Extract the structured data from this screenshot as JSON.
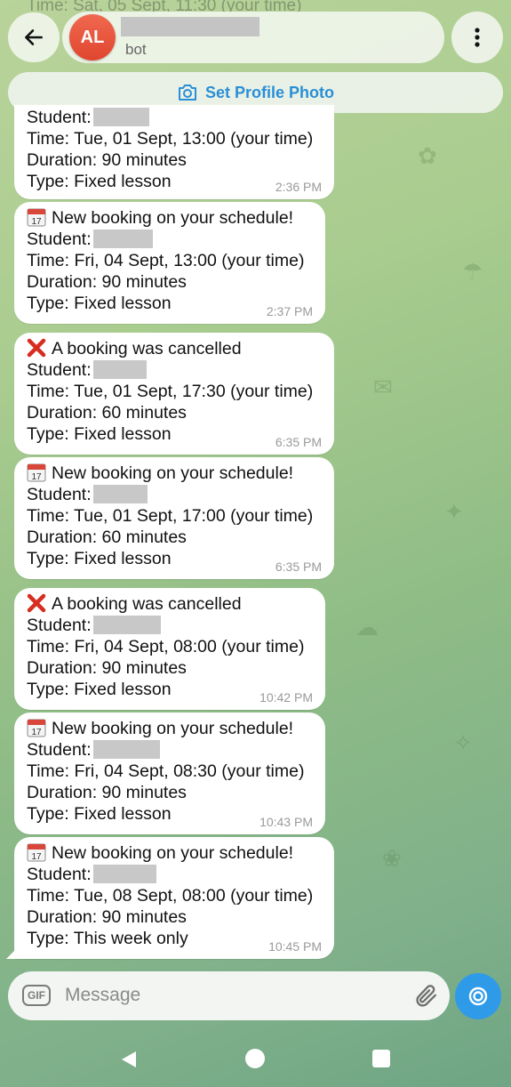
{
  "header": {
    "peek_line": "Time: Sat, 05 Sept, 11:30 (your time)",
    "avatar_initials": "AL",
    "subtitle": "bot",
    "set_profile_photo": "Set Profile Photo"
  },
  "messages": [
    {
      "title": "",
      "icon": "",
      "student_label": "Student:",
      "time": "Time: Tue, 01 Sept, 13:00 (your time)",
      "duration": "Duration: 90 minutes",
      "type": "Type: Fixed lesson",
      "timestamp": "2:36 PM"
    },
    {
      "title": "New booking on your schedule!",
      "icon": "calendar-icon",
      "student_label": "Student:",
      "time": "Time: Fri, 04 Sept, 13:00 (your time)",
      "duration": "Duration: 90 minutes",
      "type": "Type: Fixed lesson",
      "timestamp": "2:37 PM"
    },
    {
      "title": "A booking was cancelled",
      "icon": "cross-mark-icon",
      "student_label": "Student:",
      "time": "Time: Tue, 01 Sept, 17:30 (your time)",
      "duration": "Duration: 60 minutes",
      "type": "Type: Fixed lesson",
      "timestamp": "6:35 PM"
    },
    {
      "title": "New booking on your schedule!",
      "icon": "calendar-icon",
      "student_label": "Student:",
      "time": "Time: Tue, 01 Sept, 17:00 (your time)",
      "duration": "Duration: 60 minutes",
      "type": "Type: Fixed lesson",
      "timestamp": "6:35 PM"
    },
    {
      "title": "A booking was cancelled",
      "icon": "cross-mark-icon",
      "student_label": "Student:",
      "time": "Time: Fri, 04 Sept, 08:00 (your time)",
      "duration": "Duration: 90 minutes",
      "type": "Type: Fixed lesson",
      "timestamp": "10:42 PM"
    },
    {
      "title": "New booking on your schedule!",
      "icon": "calendar-icon",
      "student_label": "Student:",
      "time": "Time: Fri, 04 Sept, 08:30 (your time)",
      "duration": "Duration: 90 minutes",
      "type": "Type: Fixed lesson",
      "timestamp": "10:43 PM"
    },
    {
      "title": "New booking on your schedule!",
      "icon": "calendar-icon",
      "student_label": "Student:",
      "time": "Time: Tue, 08 Sept, 08:00 (your time)",
      "duration": "Duration: 90 minutes",
      "type": "Type: This week only",
      "timestamp": "10:45 PM"
    }
  ],
  "input": {
    "gif_label": "GIF",
    "placeholder": "Message"
  },
  "colors": {
    "accent": "#2f9be8",
    "avatar": "#e8533a",
    "cancel_red": "#d62d20"
  }
}
